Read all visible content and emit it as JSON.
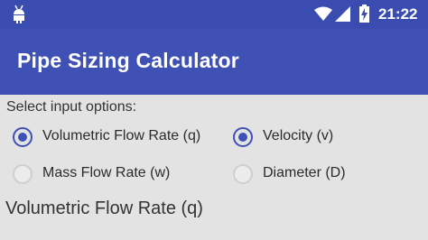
{
  "status_bar": {
    "time": "21:22",
    "icons": [
      "android-icon",
      "wifi-icon",
      "cell-signal-icon",
      "battery-charging-icon"
    ]
  },
  "app_bar": {
    "title": "Pipe Sizing Calculator",
    "color": "#3f51b5"
  },
  "main": {
    "prompt": "Select input options:",
    "options": [
      {
        "label": "Volumetric Flow Rate (q)",
        "checked": true
      },
      {
        "label": "Velocity (v)",
        "checked": true
      },
      {
        "label": "Mass Flow Rate (w)",
        "checked": false
      },
      {
        "label": "Diameter (D)",
        "checked": false
      }
    ],
    "section_title": "Volumetric Flow Rate (q)"
  },
  "colors": {
    "accent": "#3f51b5",
    "background": "#e3e3e3"
  }
}
